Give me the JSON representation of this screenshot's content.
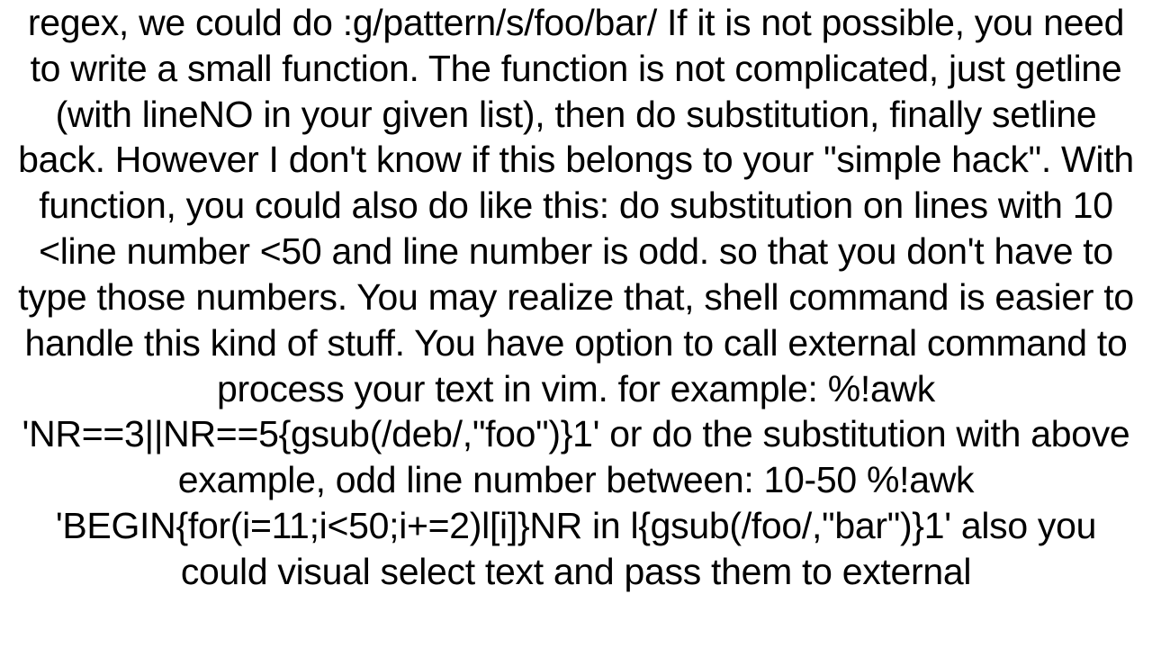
{
  "content": {
    "text": "regex, we could do :g/pattern/s/foo/bar/ If it is not possible, you need to write a small function. The function is not complicated, just getline (with lineNO in your given list), then do substitution, finally setline back. However I don't know if this belongs to your \"simple hack\". With function, you could also do like this: do substitution on lines with  10 <line number <50 and line number is odd.  so that you don't have to type those numbers. You may realize that, shell command is easier to handle this kind of stuff. You have option to call external command to process your text in vim. for example: %!awk 'NR==3||NR==5{gsub(/deb/,\"foo\")}1'  or do the substitution with above example,  odd line number between: 10-50  %!awk 'BEGIN{for(i=11;i<50;i+=2)l[i]}NR in l{gsub(/foo/,\"bar\")}1'  also you could visual select text and pass them to external"
  }
}
